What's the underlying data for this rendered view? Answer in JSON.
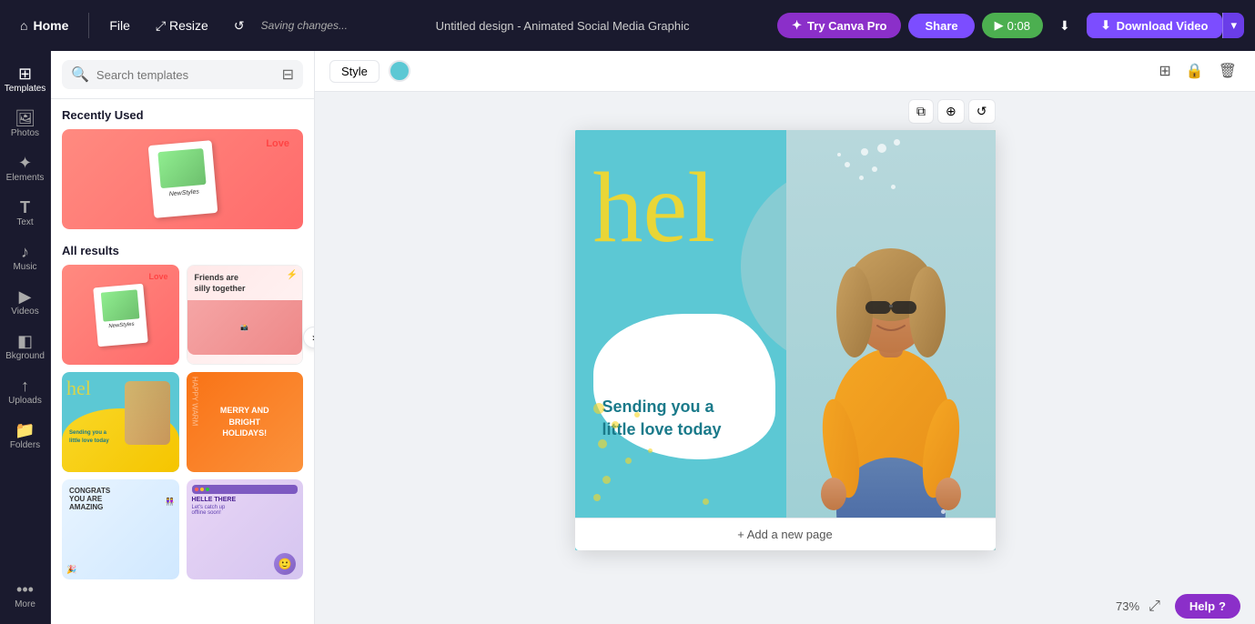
{
  "topbar": {
    "home_label": "Home",
    "file_label": "File",
    "resize_label": "Resize",
    "saving_label": "Saving changes...",
    "title": "Untitled design - Animated Social Media Graphic",
    "try_pro_label": "Try Canva Pro",
    "share_label": "Share",
    "play_time": "0:08",
    "download_label": "Download Video"
  },
  "sidebar": {
    "items": [
      {
        "id": "templates",
        "label": "Templates",
        "icon": "⊞"
      },
      {
        "id": "photos",
        "label": "Photos",
        "icon": "🖼"
      },
      {
        "id": "elements",
        "label": "Elements",
        "icon": "✦"
      },
      {
        "id": "text",
        "label": "Text",
        "icon": "T"
      },
      {
        "id": "music",
        "label": "Music",
        "icon": "♪"
      },
      {
        "id": "videos",
        "label": "Videos",
        "icon": "▶"
      },
      {
        "id": "bkground",
        "label": "Bkground",
        "icon": "◧"
      },
      {
        "id": "uploads",
        "label": "Uploads",
        "icon": "↑"
      },
      {
        "id": "folders",
        "label": "Folders",
        "icon": "📁"
      },
      {
        "id": "more",
        "label": "More",
        "icon": "···"
      }
    ]
  },
  "templates_panel": {
    "search_placeholder": "Search templates",
    "recently_used_title": "Recently Used",
    "all_results_title": "All results",
    "filter_icon": "⊟"
  },
  "canvas_toolbar": {
    "style_label": "Style",
    "color_value": "#5cc8d4"
  },
  "canvas": {
    "hello_text": "hel",
    "sending_text": "Sending you a\nlittle love today",
    "add_page_label": "+ Add a new page"
  },
  "bottom_bar": {
    "zoom_level": "73%",
    "help_label": "Help",
    "help_icon": "?"
  }
}
